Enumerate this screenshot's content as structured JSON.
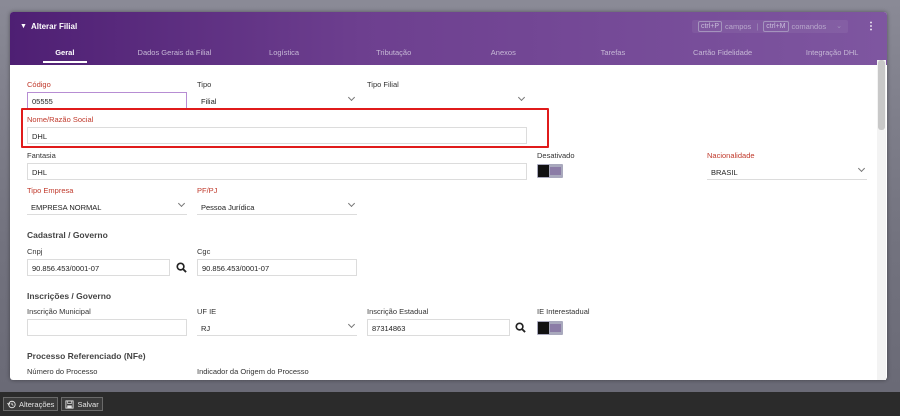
{
  "dialog": {
    "title": "Alterar Filial",
    "shortcut_fields_key": "ctrl+P",
    "shortcut_fields_label": "campos",
    "shortcut_separator": "|",
    "shortcut_commands_key": "ctrl+M",
    "shortcut_commands_label": "comandos"
  },
  "tabs": [
    {
      "label": "Geral",
      "active": true
    },
    {
      "label": "Dados Gerais da Filial"
    },
    {
      "label": "Logística"
    },
    {
      "label": "Tributação"
    },
    {
      "label": "Anexos"
    },
    {
      "label": "Tarefas"
    },
    {
      "label": "Cartão Fidelidade"
    },
    {
      "label": "Integração DHL"
    }
  ],
  "form": {
    "codigo_label": "Código",
    "codigo_value": "05555",
    "tipo_label": "Tipo",
    "tipo_value": "Filial",
    "tipo_filial_label": "Tipo Filial",
    "tipo_filial_value": "",
    "nome_label": "Nome/Razão Social",
    "nome_value": "DHL",
    "fantasia_label": "Fantasia",
    "fantasia_value": "DHL",
    "desativado_label": "Desativado",
    "nacionalidade_label": "Nacionalidade",
    "nacionalidade_value": "BRASIL",
    "tipo_empresa_label": "Tipo Empresa",
    "tipo_empresa_value": "EMPRESA NORMAL",
    "pfpj_label": "PF/PJ",
    "pfpj_value": "Pessoa Jurídica",
    "cadastral_title": "Cadastral / Governo",
    "cnpj_label": "Cnpj",
    "cnpj_value": "90.856.453/0001-07",
    "cgc_label": "Cgc",
    "cgc_value": "90.856.453/0001-07",
    "inscricoes_title": "Inscrições / Governo",
    "insc_municipal_label": "Inscrição Municipal",
    "insc_municipal_value": "",
    "uf_ie_label": "UF IE",
    "uf_ie_value": "RJ",
    "insc_estadual_label": "Inscrição Estadual",
    "insc_estadual_value": "87314863",
    "ie_interestadual_label": "IE Interestadual",
    "processo_title": "Processo Referenciado (NFe)",
    "numero_processo_label": "Número do Processo",
    "indicador_origem_label": "Indicador da Origem do Processo"
  },
  "bottom_bar": {
    "alteracoes_label": "Alterações",
    "salvar_label": "Salvar"
  },
  "colors": {
    "header": "#5b2d80",
    "required_label": "#c0392b",
    "highlight": "#e01b1b"
  }
}
